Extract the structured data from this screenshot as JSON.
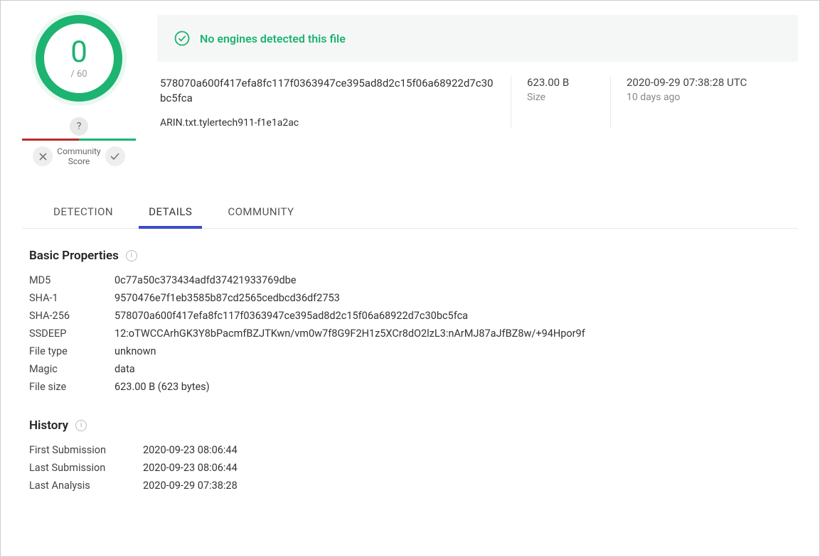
{
  "score": {
    "detections": "0",
    "total": "/ 60"
  },
  "community": {
    "label": "Community\nScore"
  },
  "banner": {
    "text": "No engines detected this file"
  },
  "file": {
    "hash_display": "578070a600f417efa8fc117f0363947ce395ad8d2c15f06a68922d7c30bc5fca",
    "filename": "ARIN.txt.tylertech911-f1e1a2ac",
    "size": "623.00 B",
    "size_label": "Size",
    "date": "2020-09-29 07:38:28 UTC",
    "date_rel": "10 days ago"
  },
  "tabs": {
    "detection": "DETECTION",
    "details": "DETAILS",
    "community": "COMMUNITY"
  },
  "basic": {
    "title": "Basic Properties",
    "rows": [
      {
        "k": "MD5",
        "v": "0c77a50c373434adfd37421933769dbe"
      },
      {
        "k": "SHA-1",
        "v": "9570476e7f1eb3585b87cd2565cedbcd36df2753"
      },
      {
        "k": "SHA-256",
        "v": "578070a600f417efa8fc117f0363947ce395ad8d2c15f06a68922d7c30bc5fca"
      },
      {
        "k": "SSDEEP",
        "v": "12:oTWCCArhGK3Y8bPacmfBZJTKwn/vm0w7f8G9F2H1z5XCr8dO2lzL3:nArMJ87aJfBZ8w/+94Hpor9f"
      },
      {
        "k": "File type",
        "v": "unknown"
      },
      {
        "k": "Magic",
        "v": "data"
      },
      {
        "k": "File size",
        "v": "623.00 B (623 bytes)"
      }
    ]
  },
  "history": {
    "title": "History",
    "rows": [
      {
        "k": "First Submission",
        "v": "2020-09-23 08:06:44"
      },
      {
        "k": "Last Submission",
        "v": "2020-09-23 08:06:44"
      },
      {
        "k": "Last Analysis",
        "v": "2020-09-29 07:38:28"
      }
    ]
  }
}
